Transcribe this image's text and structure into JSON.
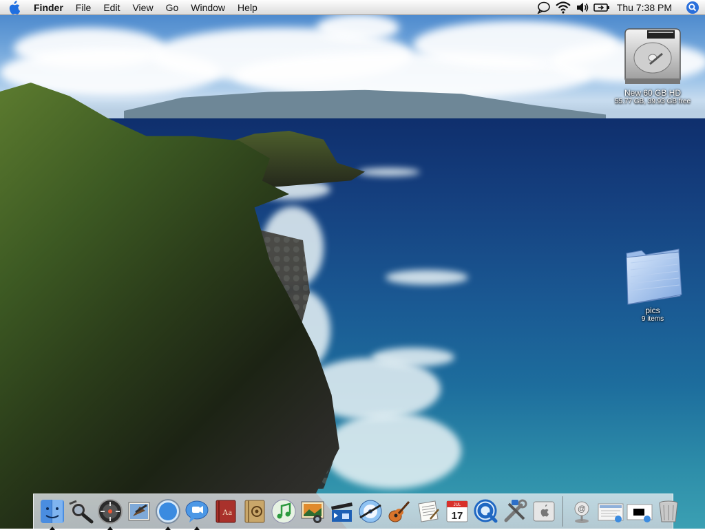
{
  "menubar": {
    "apple_icon": "apple-logo",
    "items": [
      "Finder",
      "File",
      "Edit",
      "View",
      "Go",
      "Window",
      "Help"
    ],
    "status_icons": [
      "ichat-status-icon",
      "wifi-icon",
      "volume-icon",
      "battery-icon"
    ],
    "clock": "Thu 7:38 PM",
    "spotlight_icon": "spotlight-icon"
  },
  "desktop": {
    "hard_drive": {
      "name": "New 60 GB HD",
      "info": "55.77 GB, 39.93 GB free"
    },
    "folder": {
      "name": "pics",
      "info": "9 items"
    }
  },
  "dock": {
    "apps": [
      {
        "name": "finder-icon",
        "running": true
      },
      {
        "name": "dashboard-icon",
        "running": false
      },
      {
        "name": "system-preferences-icon",
        "running": true
      },
      {
        "name": "mail-icon",
        "running": false
      },
      {
        "name": "safari-icon",
        "running": true
      },
      {
        "name": "ichat-icon",
        "running": true
      },
      {
        "name": "dictionary-icon",
        "running": false
      },
      {
        "name": "address-book-icon",
        "running": false
      },
      {
        "name": "itunes-icon",
        "running": false
      },
      {
        "name": "iphoto-icon",
        "running": false
      },
      {
        "name": "imovie-icon",
        "running": false
      },
      {
        "name": "idvd-icon",
        "running": false
      },
      {
        "name": "garageband-icon",
        "running": false
      },
      {
        "name": "textedit-icon",
        "running": false
      },
      {
        "name": "ical-icon",
        "running": false
      },
      {
        "name": "quicktime-icon",
        "running": false
      },
      {
        "name": "utilities-icon",
        "running": false
      },
      {
        "name": "apple-info-icon",
        "running": false
      }
    ],
    "ical_day": "17",
    "ical_month": "JUL",
    "dictionary_text": "Aa",
    "others": [
      {
        "name": "network-stack-icon"
      },
      {
        "name": "documents-stack-icon"
      },
      {
        "name": "minimized-window-icon"
      },
      {
        "name": "trash-icon"
      }
    ]
  },
  "colors": {
    "menubar_bg": "#ececec",
    "sea": "#1a5993",
    "spotlight_blue": "#2a6fdb"
  }
}
